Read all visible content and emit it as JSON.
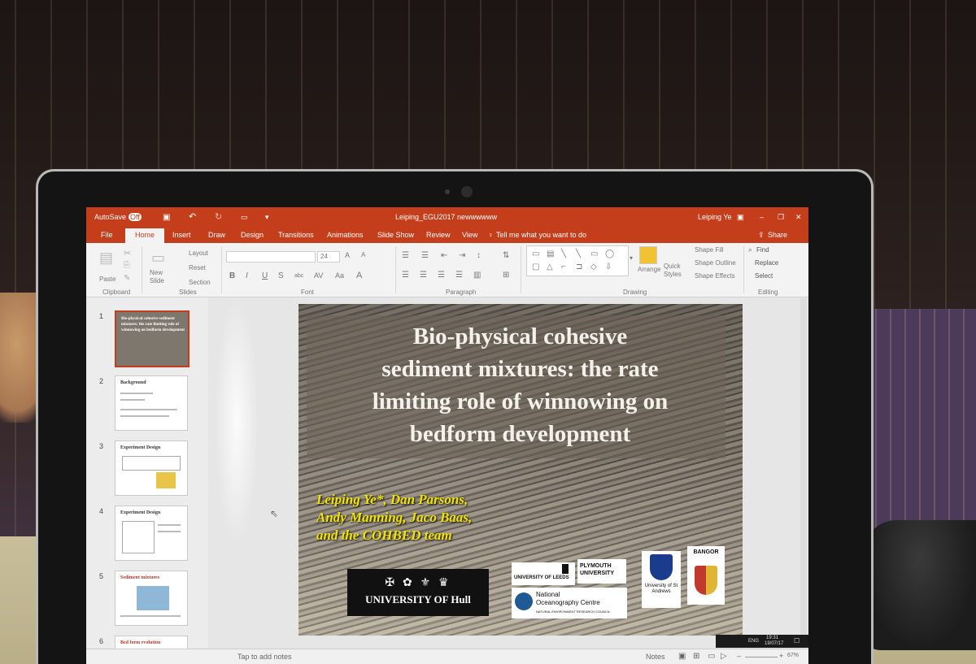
{
  "titlebar": {
    "autosave": "AutoSave",
    "autosave_state": "Off",
    "document_title": "Leiping_EGU2017 newwwwww",
    "user": "Leiping Ye",
    "share": "Share"
  },
  "tabs": [
    "File",
    "Home",
    "Insert",
    "Draw",
    "Design",
    "Transitions",
    "Animations",
    "Slide Show",
    "Review",
    "View"
  ],
  "tell_me": "Tell me what you want to do",
  "ribbon": {
    "paste": "Paste",
    "new_slide": "New Slide",
    "layout": "Layout",
    "reset": "Reset",
    "section": "Section",
    "font_size": "24",
    "arrange": "Arrange",
    "quick_styles": "Quick Styles",
    "shape_fill": "Shape Fill",
    "shape_outline": "Shape Outline",
    "shape_effects": "Shape Effects",
    "find": "Find",
    "replace": "Replace",
    "select": "Select",
    "groups": {
      "clipboard": "Clipboard",
      "slides": "Slides",
      "font": "Font",
      "paragraph": "Paragraph",
      "drawing": "Drawing",
      "editing": "Editing"
    }
  },
  "thumbnails": [
    {
      "num": "1",
      "title": "Bio-physical cohesive sediment mixtures: the rate limiting role of winnowing on bedform development"
    },
    {
      "num": "2",
      "title": "Background"
    },
    {
      "num": "3",
      "title": "Experiment Design"
    },
    {
      "num": "4",
      "title": "Experiment Design"
    },
    {
      "num": "5",
      "title": "Sediment mixtures"
    },
    {
      "num": "6",
      "title": "Bed form evolution"
    }
  ],
  "slide": {
    "title": "Bio-physical cohesive\nsediment mixtures: the rate\nlimiting role of winnowing on\nbedform development",
    "authors": "Leiping Ye*, Dan Parsons,\nAndy Manning, Jaco Baas,\nand the COHBED team",
    "logos": {
      "hull": "UNIVERSITY OF Hull",
      "leeds": "UNIVERSITY OF LEEDS",
      "plymouth": "PLYMOUTH UNIVERSITY",
      "noc_line1": "National",
      "noc_line2": "Oceanography Centre",
      "noc_line3": "NATURAL ENVIRONMENT RESEARCH COUNCIL",
      "standrews": "University of St Andrews",
      "bangor": "BANGOR"
    }
  },
  "notes": {
    "placeholder": "Tap to add notes",
    "notes_button": "Notes",
    "zoom": "67%",
    "lang": "ENG",
    "time": "19:31",
    "date": "19/07/17"
  },
  "colors": {
    "accent": "#c43e1c",
    "author_text": "#f2e400"
  }
}
